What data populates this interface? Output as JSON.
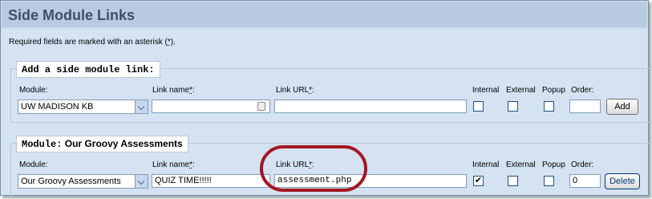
{
  "page": {
    "title": "Side Module Links",
    "required_note_prefix": "Required fields are marked with an asterisk (",
    "required_note_ast": "*",
    "required_note_suffix": ")."
  },
  "add_section": {
    "legend": "Add a side module link:",
    "labels": {
      "module": "Module:",
      "link_name": "Link name",
      "link_url": "Link URL",
      "internal": "Internal",
      "external": "External",
      "popup": "Popup",
      "order": "Order:",
      "ast": "*",
      "colon": ":"
    },
    "module_value": "UW MADISON KB",
    "link_name_value": "",
    "link_url_value": "",
    "order_value": "",
    "add_label": "Add"
  },
  "module_section": {
    "legend_prefix": "Module:",
    "legend_name": "Our Groovy Assessments",
    "labels": {
      "module": "Module:",
      "link_name": "Link name",
      "link_url": "Link URL",
      "internal": "Internal",
      "external": "External",
      "popup": "Popup",
      "order": "Order:",
      "ast": "*",
      "colon": ":"
    },
    "module_value": "Our Groovy Assessments",
    "link_name_value": "QUIZ TIME!!!!!",
    "link_url_value": "assessment.php",
    "internal_checked": "✔",
    "order_value": "0",
    "delete_label": "Delete"
  },
  "colors": {
    "annotation": "#a31820",
    "background": "#d4e2f2",
    "title": "#3d4f66"
  }
}
